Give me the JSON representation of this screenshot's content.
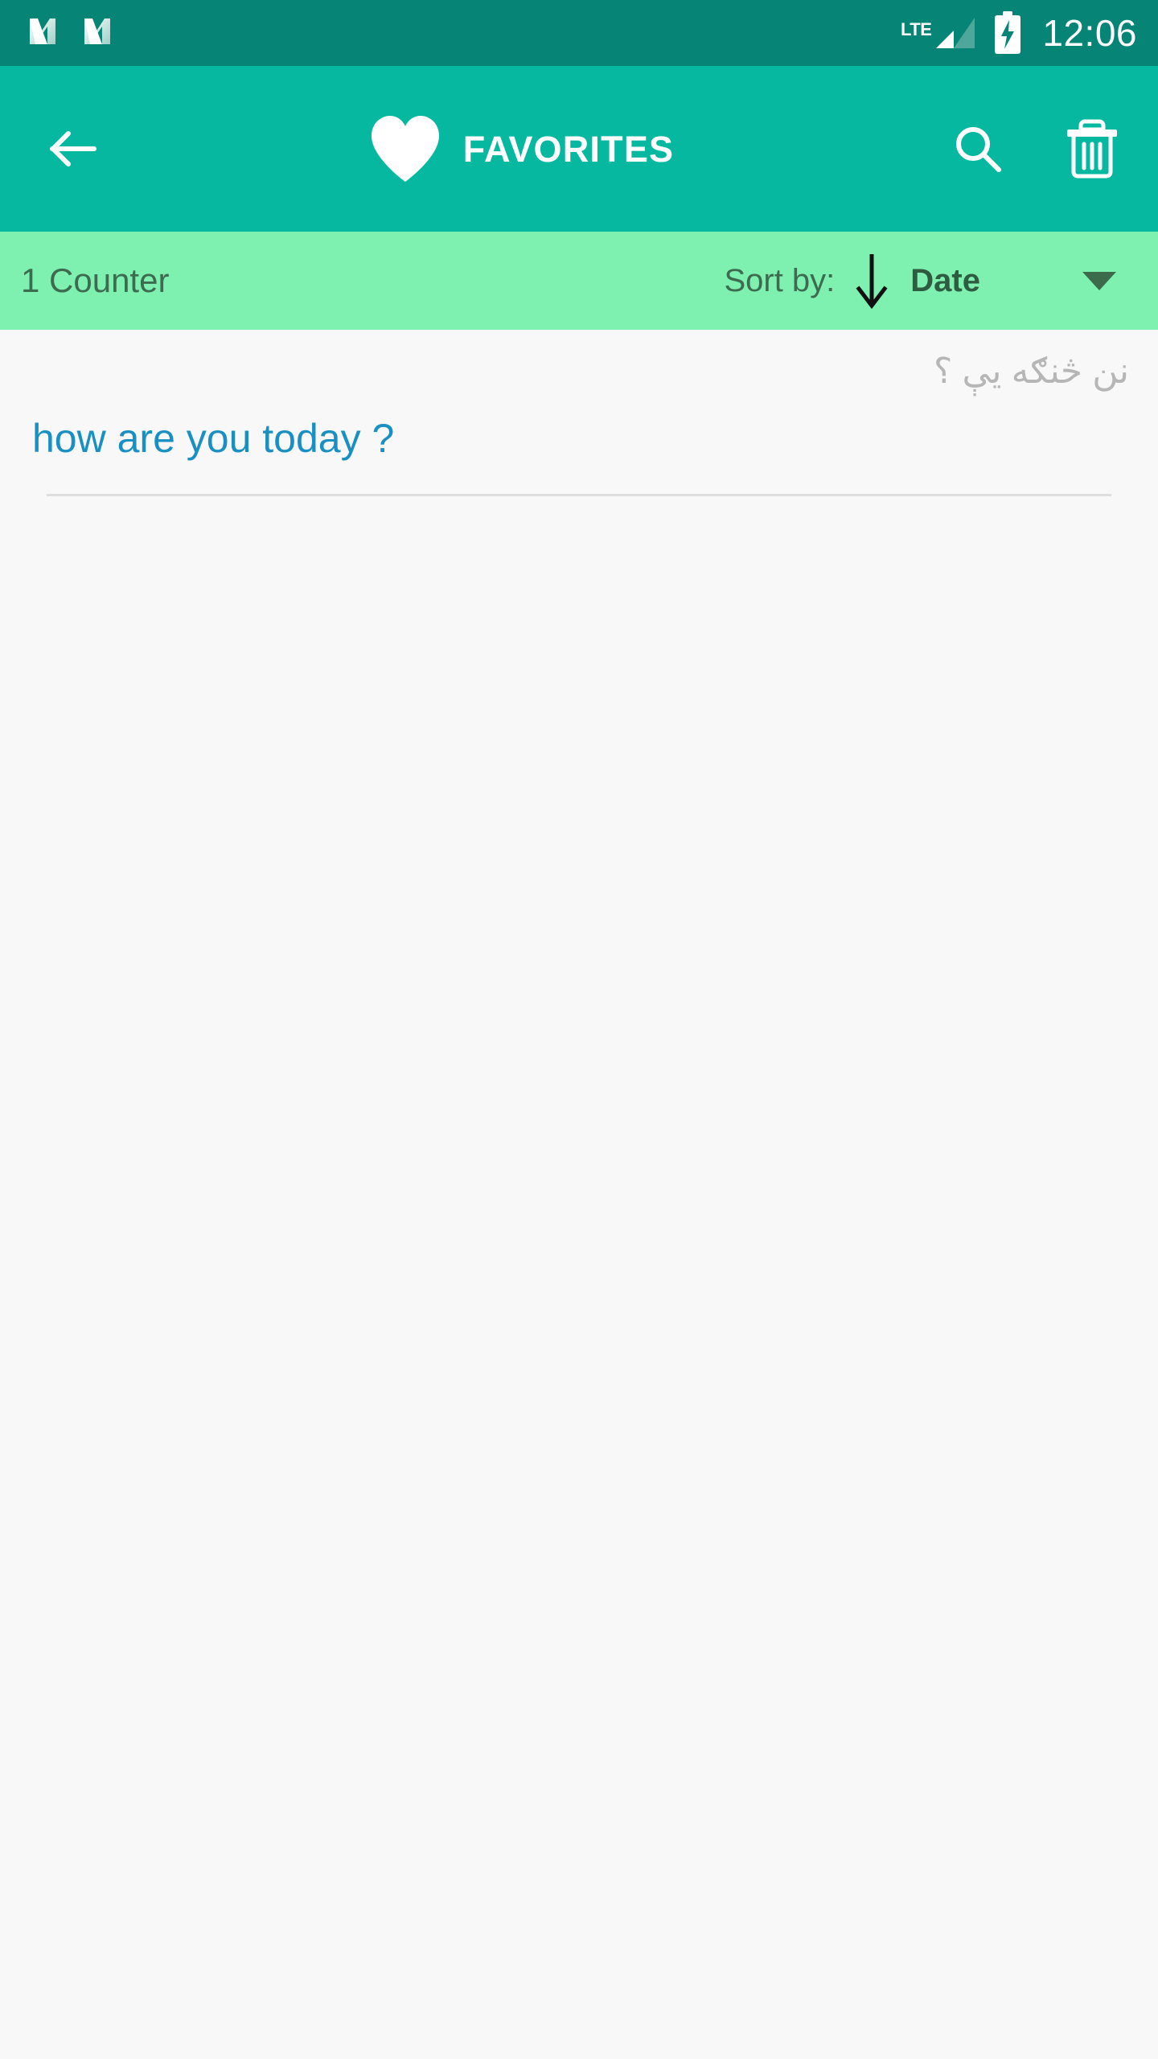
{
  "status_bar": {
    "background_color": "#068577",
    "notifications": [
      {
        "icon": "android-nougat-icon",
        "label": "N"
      },
      {
        "icon": "android-nougat-icon",
        "label": "N"
      }
    ],
    "network_type": "LTE",
    "signal_icon": "signal-bars-icon",
    "battery_icon": "battery-charging-icon",
    "time": "12:06"
  },
  "app_bar": {
    "background_color": "#06b89f",
    "back_icon": "arrow-left-icon",
    "heart_icon": "heart-filled-icon",
    "title": "FAVORITES",
    "actions": [
      {
        "icon": "search-icon",
        "label": "Search"
      },
      {
        "icon": "trash-icon",
        "label": "Delete"
      }
    ]
  },
  "sort_bar": {
    "background_color": "#7ef0b0",
    "counter_text": "1 Counter",
    "sort_label": "Sort by:",
    "sort_direction_icon": "arrow-down-icon",
    "sort_direction": "descending",
    "sort_value": "Date",
    "dropdown_icon": "triangle-down-icon"
  },
  "content": {
    "background_color": "#f8f8f8",
    "accent_color": "#1a8fc1",
    "items": [
      {
        "native_text": "نن څنګه يې ؟",
        "translation": "how are you today ?"
      }
    ]
  }
}
